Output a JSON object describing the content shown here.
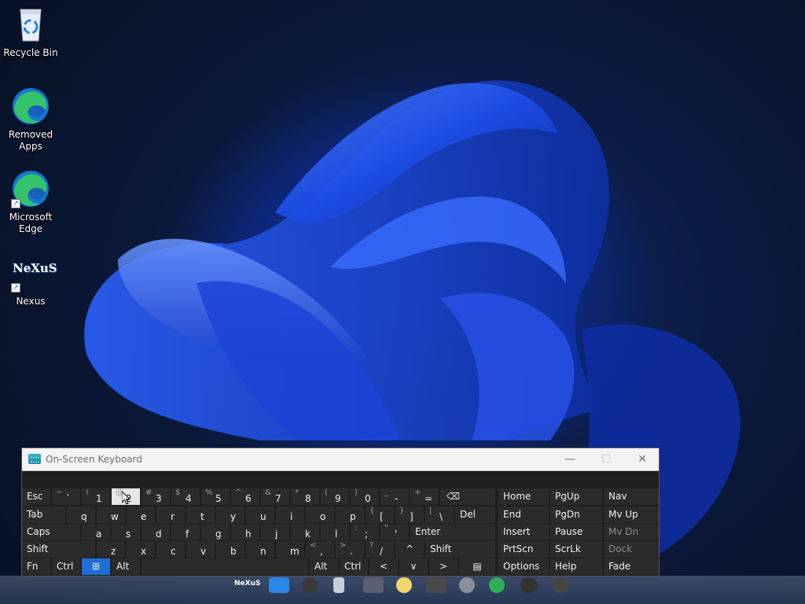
{
  "desktop": {
    "icons": [
      {
        "label": "Recycle Bin",
        "icon": "recycle-bin-icon"
      },
      {
        "label": "Removed Apps",
        "icon": "edge-icon"
      },
      {
        "label": "Microsoft Edge",
        "icon": "edge-icon"
      },
      {
        "label": "Nexus",
        "icon": "nexus-icon",
        "logo_text": "NeXuS"
      }
    ]
  },
  "osk": {
    "title": "On-Screen Keyboard",
    "controls": {
      "minimize": "—",
      "maximize": "☐",
      "close": "✕"
    },
    "rows": {
      "row1": [
        {
          "main": "Esc"
        },
        {
          "shift": "~",
          "main": "`"
        },
        {
          "shift": "!",
          "main": "1"
        },
        {
          "shift": "@",
          "main": "2"
        },
        {
          "shift": "#",
          "main": "3"
        },
        {
          "shift": "$",
          "main": "4"
        },
        {
          "shift": "%",
          "main": "5"
        },
        {
          "shift": "^",
          "main": "6"
        },
        {
          "shift": "&",
          "main": "7"
        },
        {
          "shift": "*",
          "main": "8"
        },
        {
          "shift": "(",
          "main": "9"
        },
        {
          "shift": ")",
          "main": "0"
        },
        {
          "shift": "_",
          "main": "-"
        },
        {
          "shift": "+",
          "main": "="
        },
        {
          "main": "⌫"
        }
      ],
      "row2": [
        "Tab",
        "q",
        "w",
        "e",
        "r",
        "t",
        "y",
        "u",
        "i",
        "o",
        "p",
        {
          "shift": "{",
          "main": "["
        },
        {
          "shift": "}",
          "main": "]"
        },
        {
          "shift": "|",
          "main": "\\"
        },
        "Del"
      ],
      "row3": [
        "Caps",
        "a",
        "s",
        "d",
        "f",
        "g",
        "h",
        "j",
        "k",
        "l",
        {
          "shift": ":",
          "main": ";"
        },
        {
          "shift": "\"",
          "main": "'"
        },
        "Enter"
      ],
      "row4": [
        "Shift",
        "z",
        "x",
        "c",
        "v",
        "b",
        "n",
        "m",
        {
          "shift": "<",
          "main": ","
        },
        {
          "shift": ">",
          "main": "."
        },
        {
          "shift": "?",
          "main": "/"
        },
        "^",
        "Shift"
      ],
      "row5": [
        "Fn",
        "Ctrl",
        "⊞",
        "Alt",
        "",
        "Alt",
        "Ctrl",
        "<",
        "∨",
        ">",
        "▤"
      ]
    },
    "nav": [
      [
        "Home",
        "PgUp",
        "Nav"
      ],
      [
        "End",
        "PgDn",
        "Mv Up"
      ],
      [
        "Insert",
        "Pause",
        "Mv Dn"
      ],
      [
        "PrtScn",
        "ScrLk",
        "Dock"
      ],
      [
        "Options",
        "Help",
        "Fade"
      ]
    ]
  },
  "taskbar": {
    "nexus_label": "NeXuS"
  }
}
